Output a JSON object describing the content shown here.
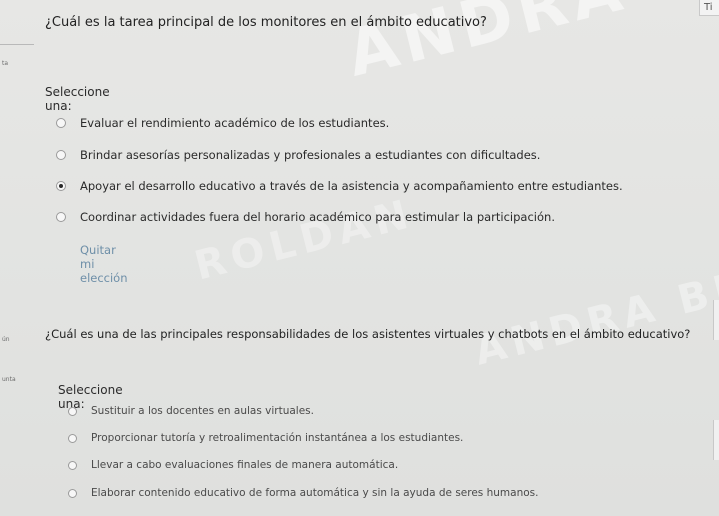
{
  "header": {
    "timer_fragment": "Ti"
  },
  "left_strip": {
    "label_q1": "ta",
    "label_q2a": "ún",
    "label_q2b": "unta"
  },
  "watermark": {
    "text1": "ANDRA BERT",
    "text2": "ROLDAN",
    "text3": "ANDRA BER"
  },
  "question1": {
    "text": "¿Cuál es la tarea principal de los monitores en el ámbito educativo?",
    "prompt": "Seleccione una:",
    "options": [
      "Evaluar el rendimiento académico de los estudiantes.",
      "Brindar asesorías personalizadas y profesionales a estudiantes con dificultades.",
      "Apoyar el desarrollo educativo a través de la asistencia y acompañamiento entre estudiantes.",
      "Coordinar actividades fuera del horario académico para estimular la participación."
    ],
    "selected_index": 2,
    "clear_label": "Quitar mi elección"
  },
  "question2": {
    "text": "¿Cuál es una de las principales responsabilidades de los asistentes virtuales y chatbots en el ámbito educativo?",
    "prompt": "Seleccione una:",
    "options": [
      "Sustituir a los docentes en aulas virtuales.",
      "Proporcionar tutoría y retroalimentación instantánea a los estudiantes.",
      "Llevar a cabo evaluaciones finales de manera automática.",
      "Elaborar contenido educativo de forma automática y sin la ayuda de seres humanos."
    ]
  }
}
